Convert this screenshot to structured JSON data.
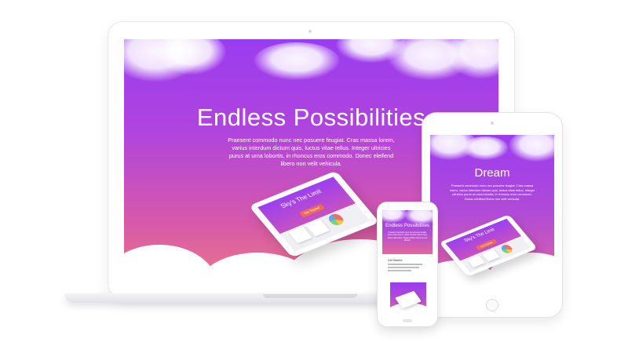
{
  "laptop": {
    "headline": "Endless Possibilities",
    "body": "Praesent commodo nunc nec posuere feugiat. Cras massa lorem, varius interdum dictum quis, luctus vitae tellus. Integer ultricies purus at urna lobortis, in rhoncus eros commodo. Donec eleifend libero non velit vehicula.",
    "mock_title": "Sky's The Limit",
    "mock_button": "Get Started"
  },
  "tablet": {
    "headline": "Dream",
    "body": "Praesent commodo nunc nec posuere feugiat. Cras massa lorem, varius interdum dictum quis, luctus vitae tellus. Integer ultricies purus at urna lobortis, in rhoncus eros commodo. Donec eleifend libero non velit vehicula.",
    "mock_title": "Sky's The Limit",
    "mock_button": "Get Started"
  },
  "phone": {
    "headline": "Endless Possibilities",
    "body": "Praesent commodo nunc nec posuere feugiat. Cras massa lorem, varius interdum dictum quis, luctus vitae tellus. Integer ultricies purus at urna lobortis.",
    "subheading": "Get Started"
  },
  "colors": {
    "sky_top": "#9a3cf0",
    "sky_mid": "#b044de",
    "sky_bottom": "#f07e82",
    "button": "#ef6a55"
  }
}
